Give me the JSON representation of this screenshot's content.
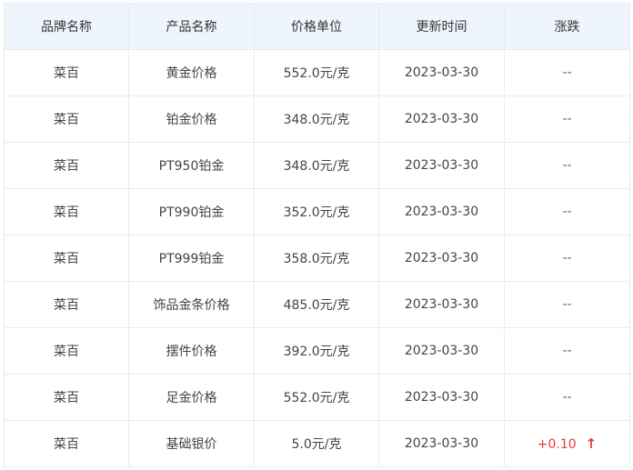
{
  "table": {
    "headers": [
      "品牌名称",
      "产品名称",
      "价格单位",
      "更新时间",
      "涨跌"
    ],
    "rows": [
      {
        "brand": "菜百",
        "product": "黄金价格",
        "price": "552.0元/克",
        "date": "2023-03-30",
        "change": "--"
      },
      {
        "brand": "菜百",
        "product": "铂金价格",
        "price": "348.0元/克",
        "date": "2023-03-30",
        "change": "--"
      },
      {
        "brand": "菜百",
        "product": "PT950铂金",
        "price": "348.0元/克",
        "date": "2023-03-30",
        "change": "--"
      },
      {
        "brand": "菜百",
        "product": "PT990铂金",
        "price": "352.0元/克",
        "date": "2023-03-30",
        "change": "--"
      },
      {
        "brand": "菜百",
        "product": "PT999铂金",
        "price": "358.0元/克",
        "date": "2023-03-30",
        "change": "--"
      },
      {
        "brand": "菜百",
        "product": "饰品金条价格",
        "price": "485.0元/克",
        "date": "2023-03-30",
        "change": "--"
      },
      {
        "brand": "菜百",
        "product": "摆件价格",
        "price": "392.0元/克",
        "date": "2023-03-30",
        "change": "--"
      },
      {
        "brand": "菜百",
        "product": "足金价格",
        "price": "552.0元/克",
        "date": "2023-03-30",
        "change": "--"
      },
      {
        "brand": "菜百",
        "product": "基础银价",
        "price": "5.0元/克",
        "date": "2023-03-30",
        "change": "+0.10",
        "arrow": "↑",
        "arrow_icon": "arrow-up-icon"
      }
    ]
  },
  "colors": {
    "header_bg": "#eef5fc",
    "border": "#e3ecf4",
    "up": "#e8393b"
  }
}
